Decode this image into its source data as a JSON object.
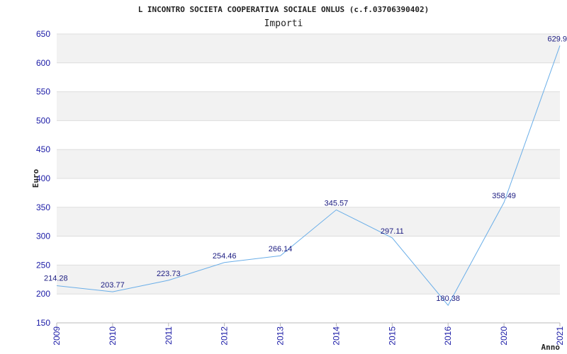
{
  "chart_data": {
    "type": "line",
    "title": "L INCONTRO SOCIETA COOPERATIVA SOCIALE ONLUS (c.f.03706390402)",
    "subtitle": "Importi",
    "xlabel": "Anno",
    "ylabel": "Euro",
    "ylim": [
      150,
      650
    ],
    "yticks": [
      150,
      200,
      250,
      300,
      350,
      400,
      450,
      500,
      550,
      600,
      650
    ],
    "categories": [
      "2009",
      "2010",
      "2011",
      "2012",
      "2013",
      "2014",
      "2015",
      "2016",
      "2020",
      "2021"
    ],
    "values": [
      214.28,
      203.77,
      223.73,
      254.46,
      266.14,
      345.57,
      297.11,
      180.38,
      358.49,
      629.9
    ],
    "data_labels": [
      "214.28",
      "203.77",
      "223.73",
      "254.46",
      "266.14",
      "345.57",
      "297.11",
      "180.38",
      "358.49",
      "629.9"
    ],
    "grid": true,
    "legend": "none",
    "colors": {
      "line": "#6aaee8",
      "band": "#f2f2f2",
      "gridline": "#dddddd",
      "tick_text": "#1a1aa6",
      "label_text": "#1a1a80"
    }
  }
}
